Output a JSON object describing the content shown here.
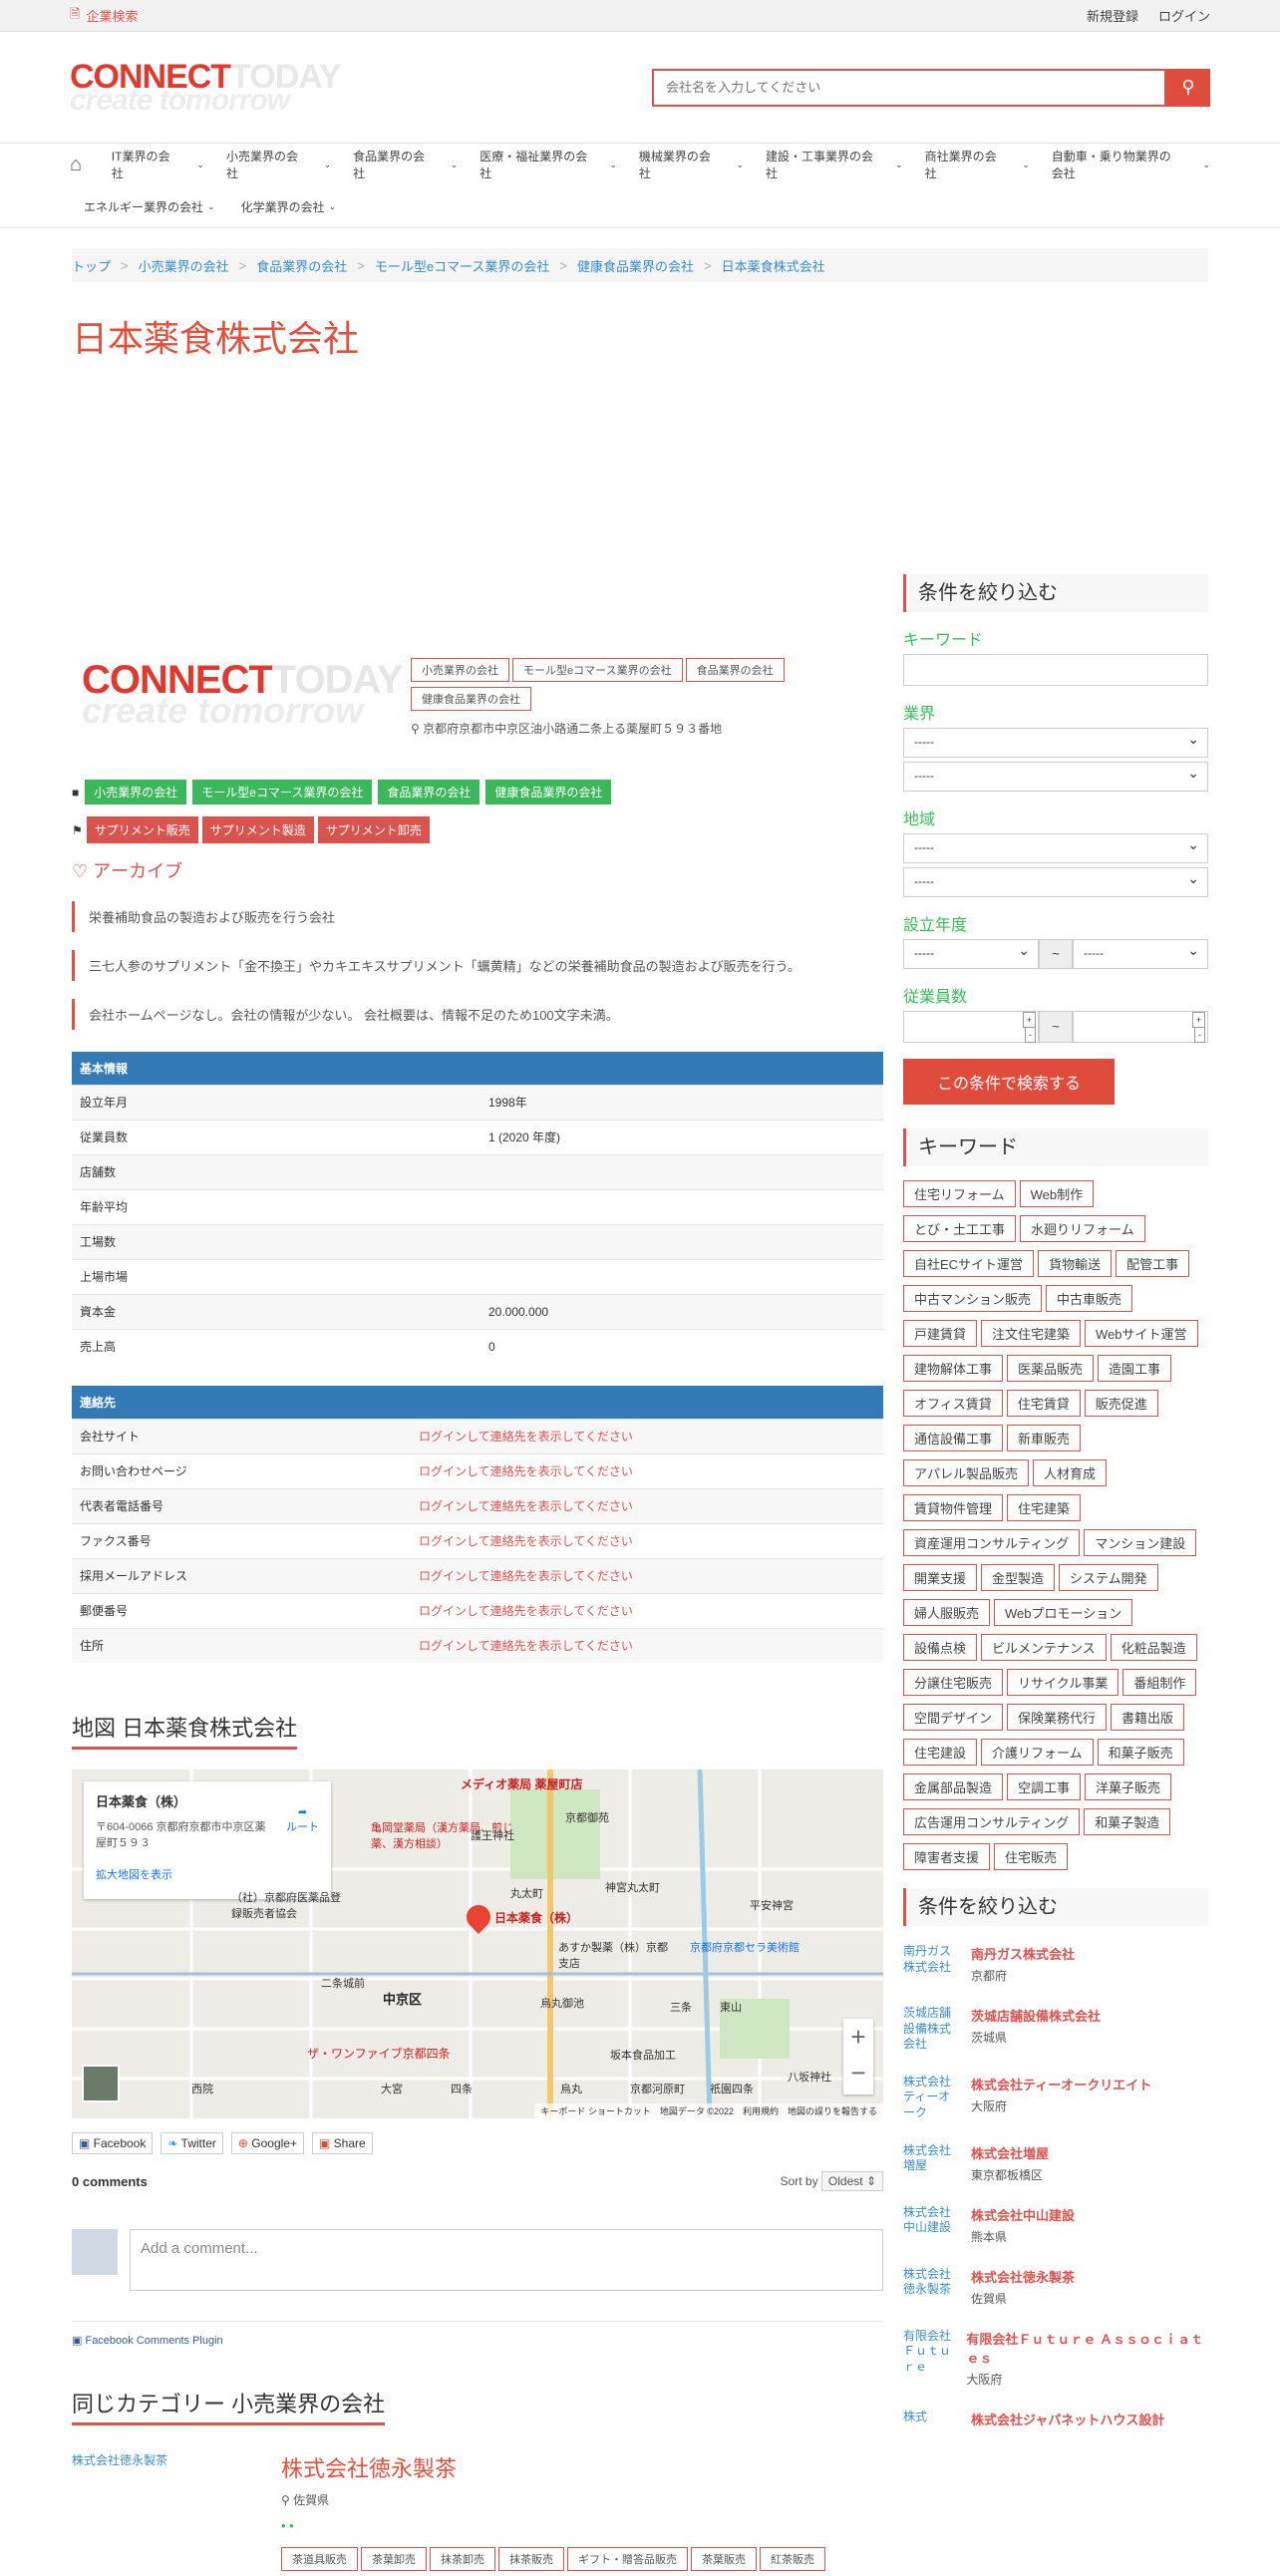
{
  "topbar": {
    "search_link": "企業検索",
    "register": "新規登録",
    "login": "ログイン"
  },
  "header": {
    "logo_main": "CONNECT",
    "logo_ghost": "TODAY",
    "logo_tagline": "create tomorrow",
    "search_placeholder": "会社名を入力してください"
  },
  "nav": {
    "row1": [
      "IT業界の会社",
      "小売業界の会社",
      "食品業界の会社",
      "医療・福祉業界の会社",
      "機械業界の会社",
      "建設・工事業界の会社",
      "商社業界の会社",
      "自動車・乗り物業界の会社"
    ],
    "row2": [
      "エネルギー業界の会社",
      "化学業界の会社"
    ]
  },
  "breadcrumb": [
    "トップ",
    "小売業界の会社",
    "食品業界の会社",
    "モール型eコマース業界の会社",
    "健康食品業界の会社",
    "日本薬食株式会社"
  ],
  "page_title": "日本薬食株式会社",
  "company": {
    "category_tags": [
      "小売業界の会社",
      "モール型eコマース業界の会社",
      "食品業界の会社",
      "健康食品業界の会社"
    ],
    "address": "京都府京都市中京区油小路通二条上る薬屋町５９３番地",
    "green_tags": [
      "小売業界の会社",
      "モール型eコマース業界の会社",
      "食品業界の会社",
      "健康食品業界の会社"
    ],
    "red_tags": [
      "サプリメント販売",
      "サプリメント製造",
      "サプリメント卸売"
    ],
    "archive": "アーカイブ",
    "desc": [
      "栄養補助食品の製造および販売を行う会社",
      "三七人参のサプリメント「金不換王」やカキエキスサプリメント「蠣黄精」などの栄養補助食品の製造および販売を行う。",
      "会社ホームページなし。会社の情報が少ない。 会社概要は、情報不足のため100文字未満。"
    ]
  },
  "basic": {
    "header": "基本情報",
    "rows": [
      [
        "設立年月",
        "1998年"
      ],
      [
        "従業員数",
        "1 (2020 年度)"
      ],
      [
        "店舗数",
        ""
      ],
      [
        "年齢平均",
        ""
      ],
      [
        "工場数",
        ""
      ],
      [
        "上場市場",
        ""
      ],
      [
        "資本金",
        "20.000.000"
      ],
      [
        "売上高",
        "0"
      ]
    ]
  },
  "contact": {
    "header": "連絡先",
    "rows": [
      [
        "会社サイト",
        "ログインして連絡先を表示してください"
      ],
      [
        "お問い合わせページ",
        "ログインして連絡先を表示してください"
      ],
      [
        "代表者電話番号",
        "ログインして連絡先を表示してください"
      ],
      [
        "ファクス番号",
        "ログインして連絡先を表示してください"
      ],
      [
        "採用メールアドレス",
        "ログインして連絡先を表示してください"
      ],
      [
        "郵便番号",
        "ログインして連絡先を表示してください"
      ],
      [
        "住所",
        "ログインして連絡先を表示してください"
      ]
    ]
  },
  "map": {
    "title": "地図 日本薬食株式会社",
    "info_name": "日本薬食（株）",
    "info_addr": "〒604-0066 京都府京都市中京区薬屋町５９３",
    "info_route": "ルート",
    "info_enlarge": "拡大地図を表示",
    "pin_label": "日本薬食（株）",
    "footer": "キーボード ショートカット　地図データ ©2022　利用規約　地図の誤りを報告する",
    "labels": [
      "メディオ薬局 薬屋町店",
      "亀岡堂薬局（漢方薬局、煎じ薬、漢方相談）",
      "京都御苑",
      "護王神社",
      "丸太町",
      "神宮丸太町",
      "平安神宮",
      "（社）京都府医薬品登録販売者協会",
      "あすか製薬（株）京都支店",
      "京都府京都セラ美術館",
      "中京区",
      "二条城前",
      "烏丸御池",
      "三条",
      "東山",
      "ザ・ワンファイブ京都四条",
      "坂本食品加工",
      "八坂神社",
      "大宮",
      "四条",
      "烏丸",
      "京都河原町",
      "祇園四条",
      "西院"
    ]
  },
  "share": [
    "Facebook",
    "Twitter",
    "Google+",
    "Share"
  ],
  "comments": {
    "count": "0 comments",
    "sort_label": "Sort by",
    "sort_value": "Oldest",
    "placeholder": "Add a comment...",
    "plugin": "Facebook Comments Plugin"
  },
  "same": {
    "title": "同じカテゴリー 小売業界の会社",
    "img_alt": "株式会社徳永製茶",
    "name": "株式会社徳永製茶",
    "pref": "佐賀県",
    "tags": [
      "茶道具販売",
      "茶葉卸売",
      "抹茶卸売",
      "抹茶販売",
      "ギフト・贈答品販売",
      "茶葉販売",
      "紅茶販売"
    ]
  },
  "sidebar": {
    "filter_title": "条件を絞り込む",
    "keyword_label": "キーワード",
    "industry_label": "業界",
    "region_label": "地域",
    "year_label": "設立年度",
    "employees_label": "従業員数",
    "select_default": "-----",
    "tilde": "~",
    "search_button": "この条件で検索する",
    "keyword_title": "キーワード",
    "keywords": [
      "住宅リフォーム",
      "Web制作",
      "とび・土工工事",
      "水廻りリフォーム",
      "自社ECサイト運営",
      "貨物輸送",
      "配管工事",
      "中古マンション販売",
      "中古車販売",
      "戸建賃貸",
      "注文住宅建築",
      "Webサイト運営",
      "建物解体工事",
      "医薬品販売",
      "造園工事",
      "オフィス賃貸",
      "住宅賃貸",
      "販売促進",
      "通信設備工事",
      "新車販売",
      "アパレル製品販売",
      "人材育成",
      "賃貸物件管理",
      "住宅建築",
      "資産運用コンサルティング",
      "マンション建設",
      "開業支援",
      "金型製造",
      "システム開発",
      "婦人服販売",
      "Webプロモーション",
      "設備点検",
      "ビルメンテナンス",
      "化粧品製造",
      "分譲住宅販売",
      "リサイクル事業",
      "番組制作",
      "空間デザイン",
      "保険業務代行",
      "書籍出版",
      "住宅建設",
      "介護リフォーム",
      "和菓子販売",
      "金属部品製造",
      "空調工事",
      "洋菓子販売",
      "広告運用コンサルティング",
      "和菓子製造",
      "障害者支援",
      "住宅販売"
    ],
    "list_title": "条件を絞り込む",
    "companies": [
      {
        "thumb": "南丹ガス株式会社",
        "name": "南丹ガス株式会社",
        "pref": "京都府"
      },
      {
        "thumb": "茨城店舗設備株式会社",
        "name": "茨城店舗設備株式会社",
        "pref": "茨城県"
      },
      {
        "thumb": "株式会社ティーオーク",
        "name": "株式会社ティーオークリエイト",
        "pref": "大阪府"
      },
      {
        "thumb": "株式会社増屋",
        "name": "株式会社増屋",
        "pref": "東京都板橋区"
      },
      {
        "thumb": "株式会社中山建設",
        "name": "株式会社中山建設",
        "pref": "熊本県"
      },
      {
        "thumb": "株式会社徳永製茶",
        "name": "株式会社徳永製茶",
        "pref": "佐賀県"
      },
      {
        "thumb": "有限会社Ｆｕｔｕｒｅ",
        "name": "有限会社Ｆｕｔｕｒｅ Ａｓｓｏｃｉａｔｅｓ",
        "pref": "大阪府"
      },
      {
        "thumb": "株式",
        "name": "株式会社ジャパネットハウス設計",
        "pref": ""
      }
    ]
  }
}
